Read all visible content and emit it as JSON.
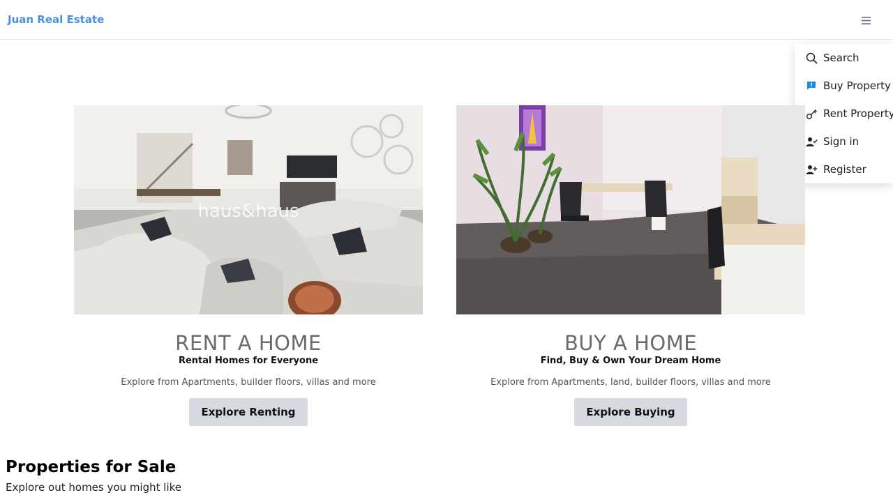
{
  "brand": {
    "name": "Juan Real Estate",
    "color": "#4a90e2"
  },
  "nav": {
    "menu_icon": "hamburger-icon"
  },
  "dropdown": {
    "items": [
      {
        "label": "Search",
        "icon": "search-icon"
      },
      {
        "label": "Buy Property",
        "icon": "info-message-icon"
      },
      {
        "label": "Rent Property",
        "icon": "key-icon"
      },
      {
        "label": "Sign in",
        "icon": "user-check-icon"
      },
      {
        "label": "Register",
        "icon": "user-plus-icon"
      }
    ]
  },
  "cards": [
    {
      "title": "RENT A HOME",
      "subtitle": "Rental Homes for Everyone",
      "description": "Explore from Apartments, builder floors, villas and more",
      "button": "Explore Renting",
      "image": "living-room-photo",
      "watermark": "haus&haus"
    },
    {
      "title": "BUY A HOME",
      "subtitle": "Find, Buy & Own Your Dream Home",
      "description": "Explore from Apartments, land, builder floors, villas and more",
      "button": "Explore Buying",
      "image": "office-room-photo"
    }
  ],
  "properties": {
    "title": "Properties for Sale",
    "subtitle": "Explore out homes you might like"
  },
  "colors": {
    "button_bg": "#d7d9e0",
    "title_gray": "#6b6b6b",
    "accent_blue": "#1e88e5"
  }
}
